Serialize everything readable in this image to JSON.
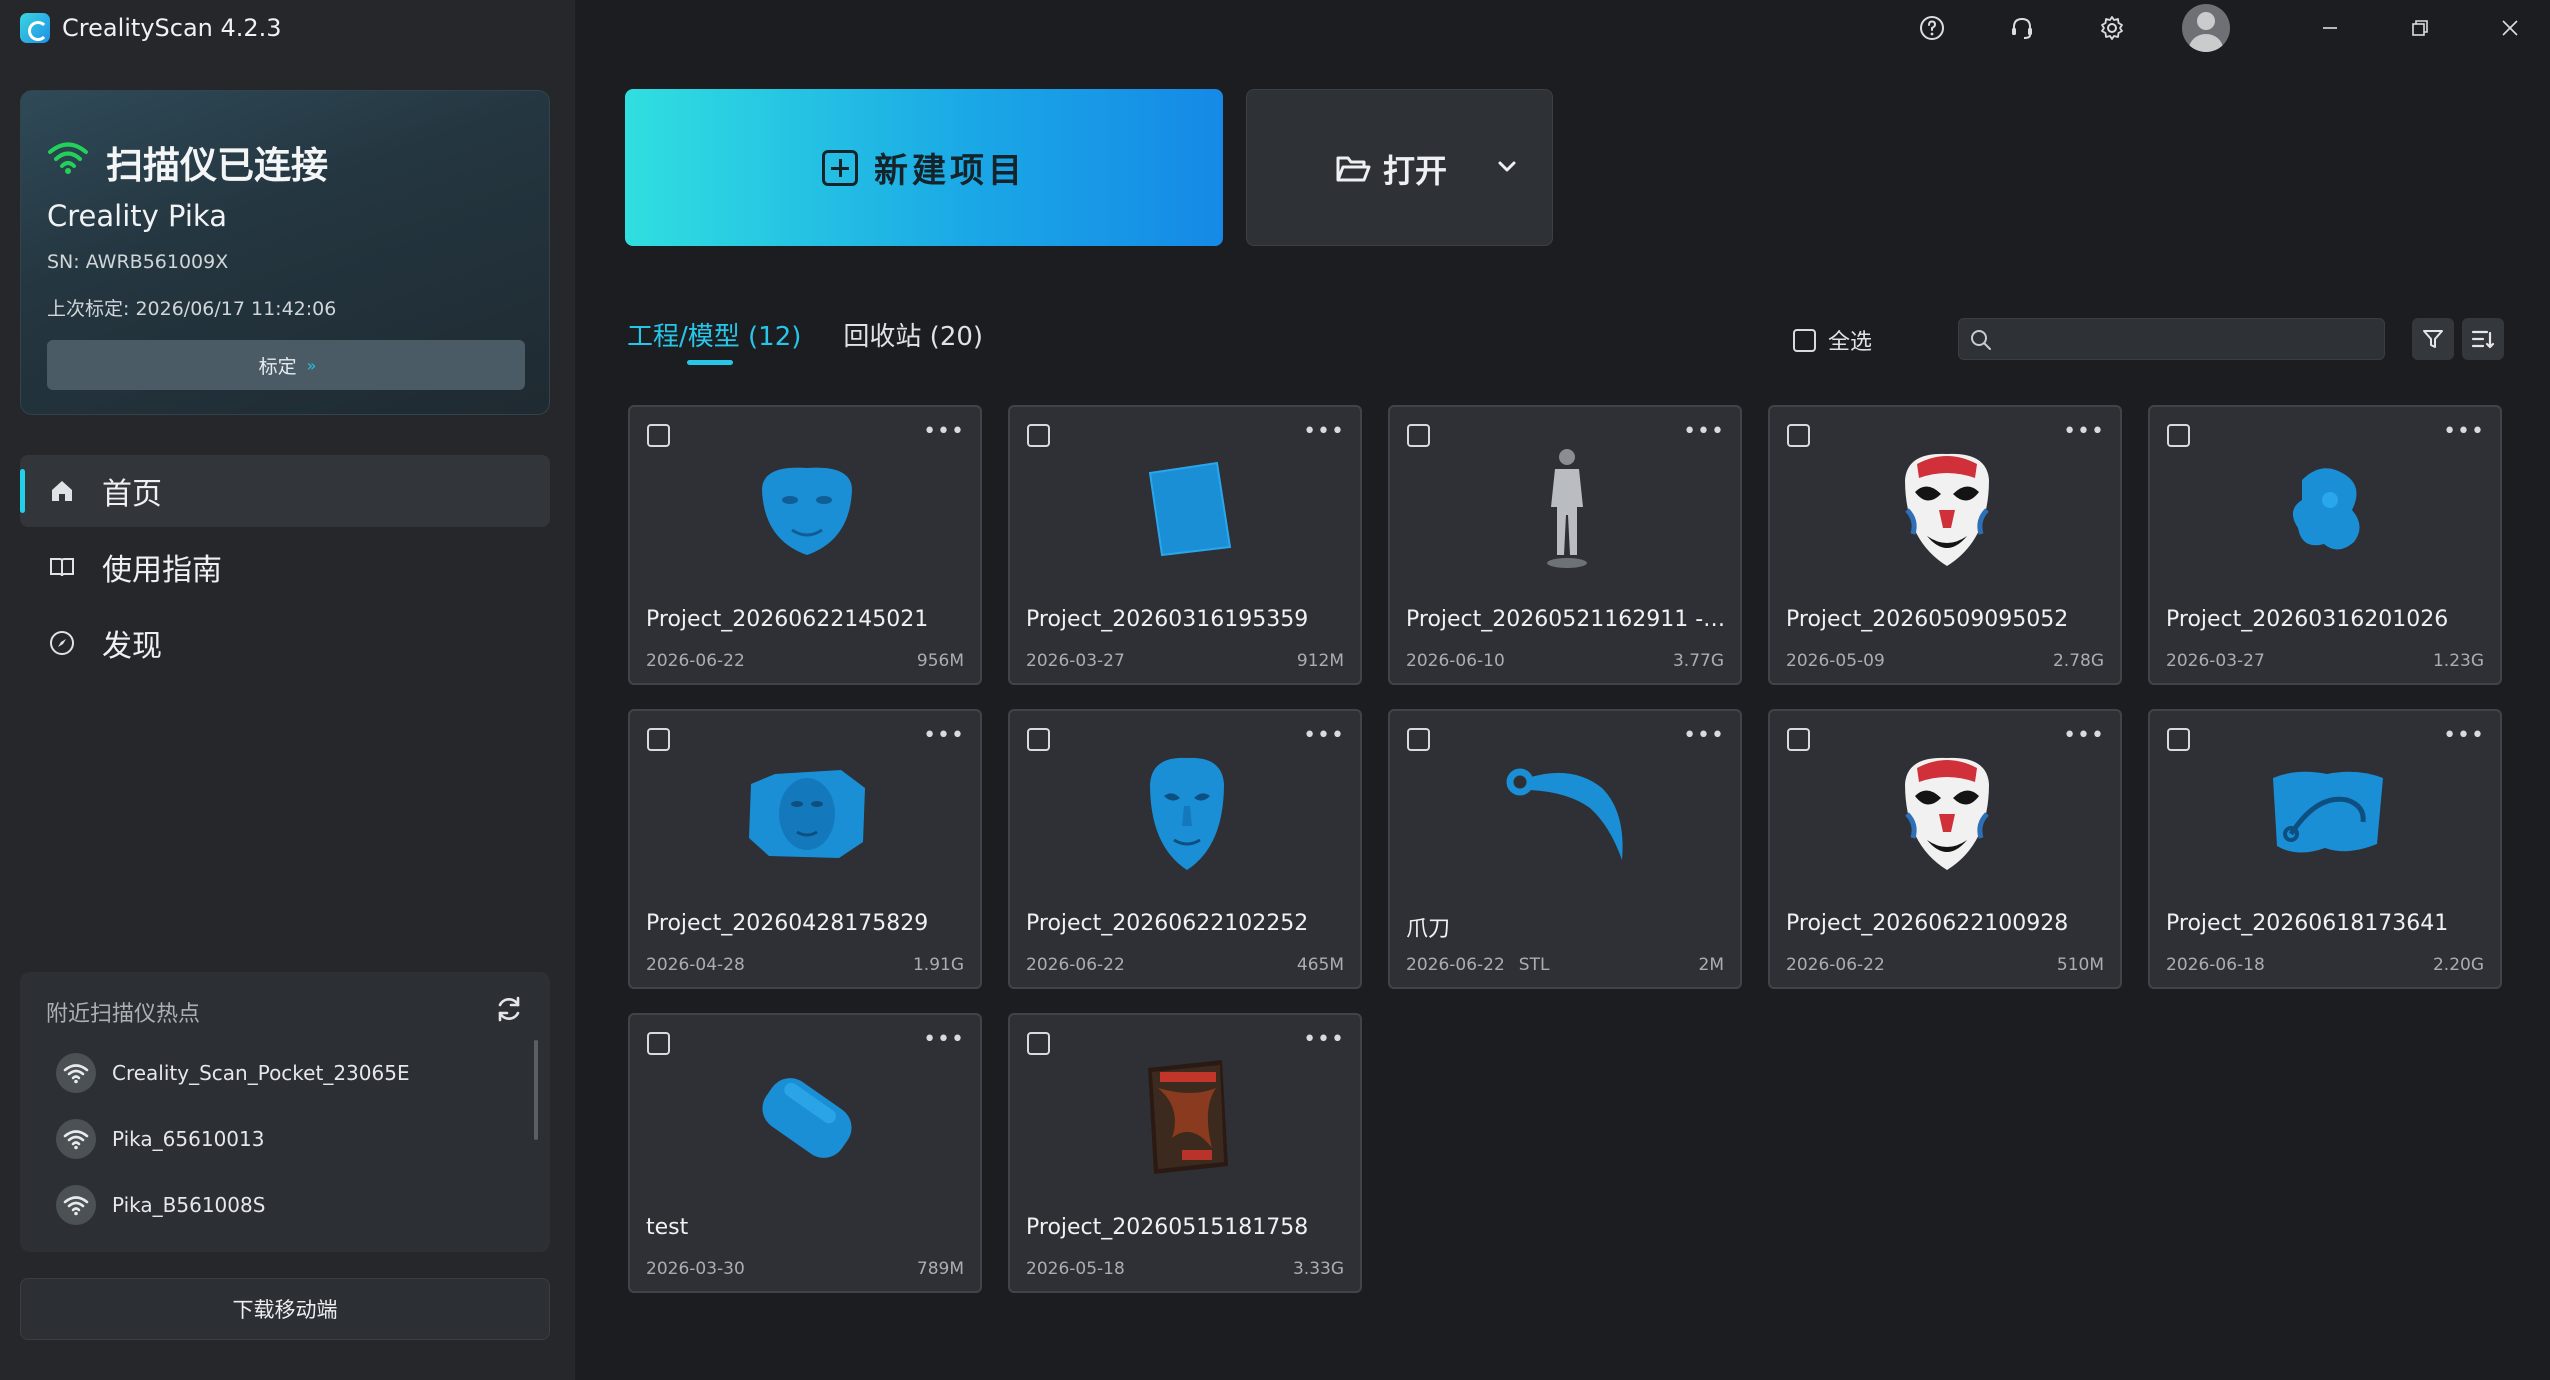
{
  "app": {
    "title": "CrealityScan 4.2.3"
  },
  "scanner": {
    "status": "扫描仪已连接",
    "name": "Creality Pika",
    "sn": "SN: AWRB561009X",
    "last_calibration": "上次标定: 2026/06/17 11:42:06",
    "calibrate_label": "标定",
    "calibrate_arrows": "»"
  },
  "nav": {
    "items": [
      {
        "label": "首页",
        "icon": "home-icon",
        "active": true
      },
      {
        "label": "使用指南",
        "icon": "book-icon",
        "active": false
      },
      {
        "label": "发现",
        "icon": "compass-icon",
        "active": false
      }
    ]
  },
  "hotspots": {
    "title": "附近扫描仪热点",
    "items": [
      {
        "name": "Creality_Scan_Pocket_23065E"
      },
      {
        "name": "Pika_65610013"
      },
      {
        "name": "Pika_B561008S"
      }
    ]
  },
  "download_label": "下载移动端",
  "main": {
    "new_project_label": "新建项目",
    "open_label": "打开",
    "tabs": [
      {
        "label": "工程/模型 (12)",
        "active": true
      },
      {
        "label": "回收站 (20)",
        "active": false
      }
    ],
    "select_all_label": "全选",
    "search": {
      "value": "",
      "placeholder": ""
    }
  },
  "projects": [
    {
      "name": "Project_20260622145021",
      "date": "2026-06-22",
      "type": "",
      "size": "956M",
      "thumb": "face"
    },
    {
      "name": "Project_20260316195359",
      "date": "2026-03-27",
      "type": "",
      "size": "912M",
      "thumb": "panel"
    },
    {
      "name": "Project_20260521162911 - ...",
      "date": "2026-06-10",
      "type": "",
      "size": "3.77G",
      "thumb": "figure"
    },
    {
      "name": "Project_20260509095052",
      "date": "2026-05-09",
      "type": "",
      "size": "2.78G",
      "thumb": "opera-mask"
    },
    {
      "name": "Project_20260316201026",
      "date": "2026-03-27",
      "type": "",
      "size": "1.23G",
      "thumb": "blob"
    },
    {
      "name": "Project_20260428175829",
      "date": "2026-04-28",
      "type": "",
      "size": "1.91G",
      "thumb": "face-patch"
    },
    {
      "name": "Project_20260622102252",
      "date": "2026-06-22",
      "type": "",
      "size": "465M",
      "thumb": "mask"
    },
    {
      "name": "爪刀",
      "date": "2026-06-22",
      "type": "STL",
      "size": "2M",
      "thumb": "karambit"
    },
    {
      "name": "Project_20260622100928",
      "date": "2026-06-22",
      "type": "",
      "size": "510M",
      "thumb": "opera-mask"
    },
    {
      "name": "Project_20260618173641",
      "date": "2026-06-18",
      "type": "",
      "size": "2.20G",
      "thumb": "cloth"
    },
    {
      "name": "test",
      "date": "2026-03-30",
      "type": "",
      "size": "789M",
      "thumb": "pill"
    },
    {
      "name": "Project_20260515181758",
      "date": "2026-05-18",
      "type": "",
      "size": "3.33G",
      "thumb": "book"
    }
  ],
  "colors": {
    "accent": "#27c6e8",
    "scan_blue": "#1a8fd6",
    "connected_green": "#22d15a"
  }
}
